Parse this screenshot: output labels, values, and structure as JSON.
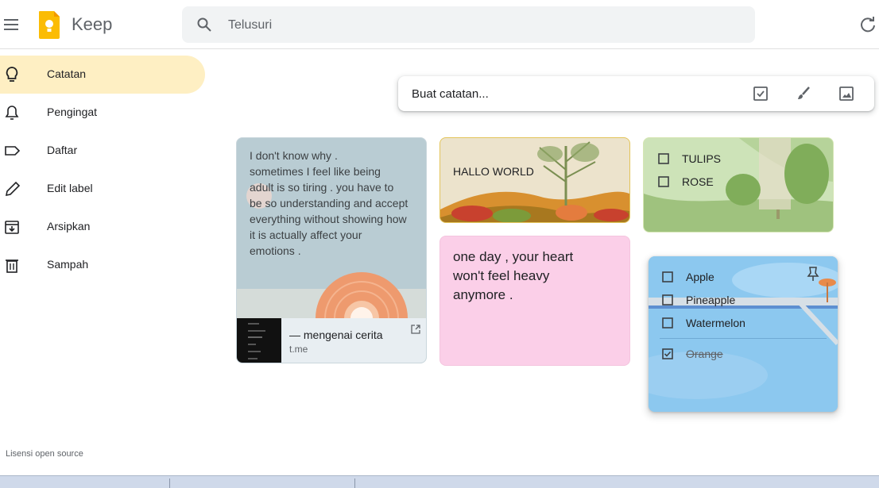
{
  "app": {
    "name": "Keep"
  },
  "search": {
    "placeholder": "Telusuri"
  },
  "sidebar": {
    "items": [
      {
        "label": "Catatan",
        "icon": "lightbulb-icon",
        "active": true
      },
      {
        "label": "Pengingat",
        "icon": "bell-icon"
      },
      {
        "label": "Daftar",
        "icon": "label-icon"
      },
      {
        "label": "Edit label",
        "icon": "pencil-icon"
      },
      {
        "label": "Arsipkan",
        "icon": "archive-icon"
      },
      {
        "label": "Sampah",
        "icon": "trash-icon"
      }
    ],
    "license": "Lisensi open source"
  },
  "take_note": {
    "placeholder": "Buat catatan..."
  },
  "notes": {
    "note1": {
      "lines": [
        "I don't know why .",
        "sometimes I feel like being",
        "adult is so tiring . you have to",
        "be so understanding and accept",
        "everything without showing how",
        "it is actually affect your",
        "emotions ."
      ],
      "link_title": "— mengenai cerita",
      "link_url": "t.me"
    },
    "note2": {
      "text": "HALLO WORLD"
    },
    "note3": {
      "lines": [
        "one day , your heart",
        "won't feel heavy",
        "anymore ."
      ]
    },
    "note4": {
      "items": [
        {
          "text": "TULIPS",
          "checked": false
        },
        {
          "text": "ROSE",
          "checked": false
        }
      ]
    },
    "note5": {
      "items": [
        {
          "text": "Apple",
          "checked": false
        },
        {
          "text": "Pineapple",
          "checked": false
        },
        {
          "text": "Watermelon",
          "checked": false
        },
        {
          "text": "Orange",
          "checked": true
        }
      ]
    }
  },
  "colors": {
    "active_nav": "#feefc3",
    "note_pink": "#fbcfe8",
    "note_blue": "#8cc8ef",
    "note_green": "#cde3b8",
    "note_sand": "#ece3cc",
    "note_slate": "#b9ccd3",
    "logo_yellow": "#fbbc04"
  }
}
